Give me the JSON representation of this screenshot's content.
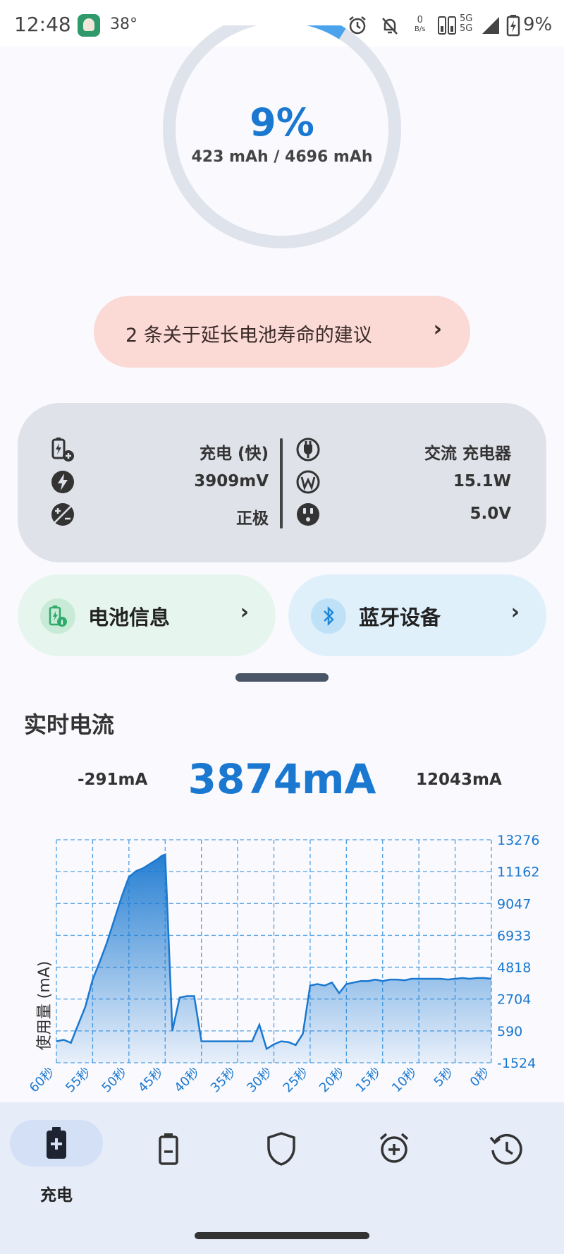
{
  "status_bar": {
    "time": "12:48",
    "temperature": "38°",
    "net_speed_value": "0",
    "net_speed_unit": "B/s",
    "network": "5G",
    "battery_pct": "9%"
  },
  "battery_ring": {
    "percent": "9%",
    "capacity": "423 mAh / 4696 mAh",
    "level_fraction": 0.09,
    "ring_color": "#dfe3ec",
    "fill_color": "#4aa3ec"
  },
  "tips": {
    "label": "2 条关于延长电池寿命的建议",
    "chevron": "›"
  },
  "info_card": {
    "left_rows": [
      {
        "icon": "battery-charging-icon",
        "value": "充电 (快)"
      },
      {
        "icon": "bolt-icon",
        "value": "3909mV"
      },
      {
        "icon": "polarity-icon",
        "value": "正极"
      }
    ],
    "right_rows": [
      {
        "icon": "plug-icon",
        "value": "交流 充电器"
      },
      {
        "icon": "watt-icon",
        "value": "15.1W"
      },
      {
        "icon": "outlet-icon",
        "value": "5.0V"
      }
    ]
  },
  "buttons": {
    "battery_info": "电池信息",
    "bluetooth": "蓝牙设备",
    "chevron": "›"
  },
  "realtime": {
    "title": "实时电流",
    "min": "-291mA",
    "current": "3874mA",
    "max": "12043mA"
  },
  "chart_data": {
    "type": "area",
    "title": "",
    "ylabel": "使用量 (mA)",
    "xlabel": "",
    "ylim": [
      -1524,
      13276
    ],
    "y_ticks": [
      "13276",
      "11162",
      "9047",
      "6933",
      "4818",
      "2704",
      "590",
      "-1524"
    ],
    "x_ticks": [
      "60秒",
      "55秒",
      "50秒",
      "45秒",
      "40秒",
      "35秒",
      "30秒",
      "25秒",
      "20秒",
      "15秒",
      "10秒",
      "5秒",
      "0秒"
    ],
    "grid": true,
    "color": "#1a78d0",
    "x": [
      60,
      59,
      58,
      57,
      56,
      55,
      54,
      53,
      52,
      51,
      50,
      49,
      48,
      47,
      46,
      45.5,
      45,
      44,
      43,
      42,
      41,
      40,
      39,
      38,
      37,
      36,
      35,
      34,
      33,
      32,
      31,
      30,
      29,
      28,
      27,
      26,
      25,
      24,
      23,
      22,
      21,
      20,
      19,
      18,
      17,
      16,
      15,
      14,
      13,
      12,
      11,
      10,
      9,
      8,
      7,
      6,
      5,
      4,
      3,
      2,
      1,
      0
    ],
    "y": [
      -100,
      0,
      -200,
      1000,
      2200,
      4000,
      5200,
      6500,
      8000,
      9500,
      10800,
      11200,
      11400,
      11700,
      12000,
      12200,
      12300,
      600,
      2800,
      2900,
      2900,
      -100,
      -100,
      -100,
      -100,
      -100,
      -100,
      -100,
      -100,
      1000,
      -600,
      -300,
      -100,
      -150,
      -350,
      400,
      3600,
      3700,
      3600,
      3800,
      3100,
      3700,
      3800,
      3900,
      3900,
      4000,
      3900,
      4000,
      4000,
      3950,
      4050,
      4050,
      4050,
      4050,
      4050,
      4000,
      4050,
      4100,
      4050,
      4100,
      4100,
      4050
    ]
  },
  "bottom_nav": {
    "active_label": "充电",
    "items": [
      "charge-icon",
      "battery-icon",
      "shield-icon",
      "alarm-add-icon",
      "history-icon"
    ]
  }
}
